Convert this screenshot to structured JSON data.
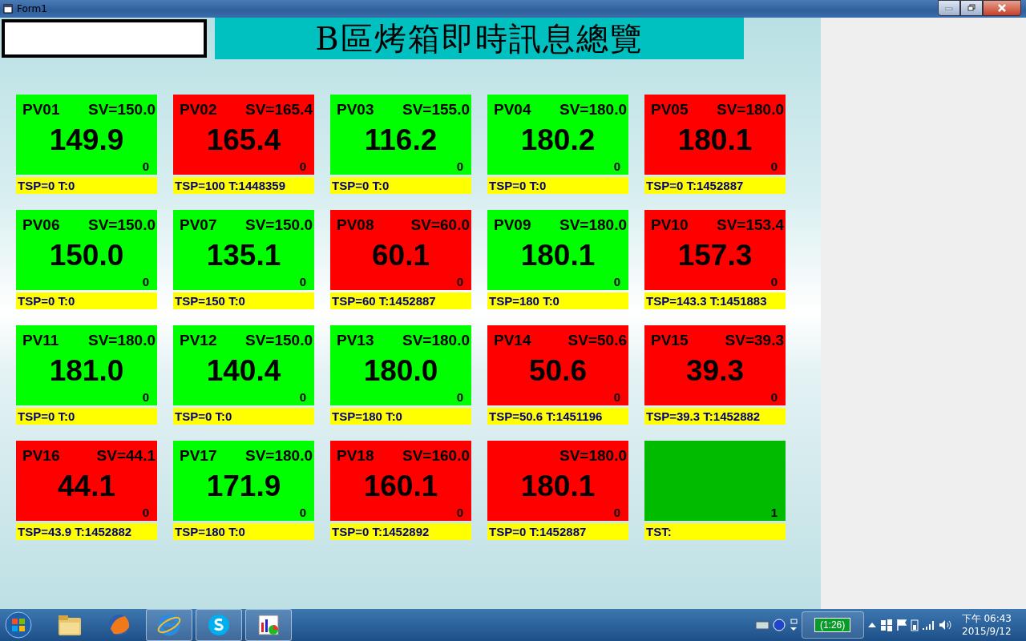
{
  "window": {
    "title": "Form1"
  },
  "header": {
    "title": "B區烤箱即時訊息總覽"
  },
  "panels": [
    {
      "name": "PV01",
      "sv": "SV=150.0",
      "pv": "149.9",
      "flag": "0",
      "footer": "TSP=0 T:0",
      "color": "#00ff00"
    },
    {
      "name": "PV02",
      "sv": "SV=165.4",
      "pv": "165.4",
      "flag": "0",
      "footer": "TSP=100 T:1448359",
      "color": "#ff0000"
    },
    {
      "name": "PV03",
      "sv": "SV=155.0",
      "pv": "116.2",
      "flag": "0",
      "footer": "TSP=0 T:0",
      "color": "#00ff00"
    },
    {
      "name": "PV04",
      "sv": "SV=180.0",
      "pv": "180.2",
      "flag": "0",
      "footer": "TSP=0 T:0",
      "color": "#00ff00"
    },
    {
      "name": "PV05",
      "sv": "SV=180.0",
      "pv": "180.1",
      "flag": "0",
      "footer": "TSP=0 T:1452887",
      "color": "#ff0000"
    },
    {
      "name": "PV06",
      "sv": "SV=150.0",
      "pv": "150.0",
      "flag": "0",
      "footer": "TSP=0 T:0",
      "color": "#00ff00"
    },
    {
      "name": "PV07",
      "sv": "SV=150.0",
      "pv": "135.1",
      "flag": "0",
      "footer": "TSP=150 T:0",
      "color": "#00ff00"
    },
    {
      "name": "PV08",
      "sv": "SV=60.0",
      "pv": "60.1",
      "flag": "0",
      "footer": "TSP=60 T:1452887",
      "color": "#ff0000"
    },
    {
      "name": "PV09",
      "sv": "SV=180.0",
      "pv": "180.1",
      "flag": "0",
      "footer": "TSP=180 T:0",
      "color": "#00ff00"
    },
    {
      "name": "PV10",
      "sv": "SV=153.4",
      "pv": "157.3",
      "flag": "0",
      "footer": "TSP=143.3 T:1451883",
      "color": "#ff0000"
    },
    {
      "name": "PV11",
      "sv": "SV=180.0",
      "pv": "181.0",
      "flag": "0",
      "footer": "TSP=0 T:0",
      "color": "#00ff00"
    },
    {
      "name": "PV12",
      "sv": "SV=150.0",
      "pv": "140.4",
      "flag": "0",
      "footer": "TSP=0 T:0",
      "color": "#00ff00"
    },
    {
      "name": "PV13",
      "sv": "SV=180.0",
      "pv": "180.0",
      "flag": "0",
      "footer": "TSP=180 T:0",
      "color": "#00ff00"
    },
    {
      "name": "PV14",
      "sv": "SV=50.6",
      "pv": "50.6",
      "flag": "0",
      "footer": "TSP=50.6 T:1451196",
      "color": "#ff0000"
    },
    {
      "name": "PV15",
      "sv": "SV=39.3",
      "pv": "39.3",
      "flag": "0",
      "footer": "TSP=39.3 T:1452882",
      "color": "#ff0000"
    },
    {
      "name": "PV16",
      "sv": "SV=44.1",
      "pv": "44.1",
      "flag": "0",
      "footer": "TSP=43.9 T:1452882",
      "color": "#ff0000"
    },
    {
      "name": "PV17",
      "sv": "SV=180.0",
      "pv": "171.9",
      "flag": "0",
      "footer": "TSP=180 T:0",
      "color": "#00ff00"
    },
    {
      "name": "PV18",
      "sv": "SV=160.0",
      "pv": "160.1",
      "flag": "0",
      "footer": "TSP=0 T:1452892",
      "color": "#ff0000"
    },
    {
      "sv": "SV=180.0",
      "pv": "180.1",
      "flag": "0",
      "footer": "TSP=0 T:1452887",
      "color": "#ff0000"
    },
    {
      "flag": "1",
      "footer": "TST:",
      "color": "#00bb00"
    }
  ],
  "taskbar": {
    "battery": "(1:26)",
    "time": "下午 06:43",
    "date": "2015/9/12"
  }
}
